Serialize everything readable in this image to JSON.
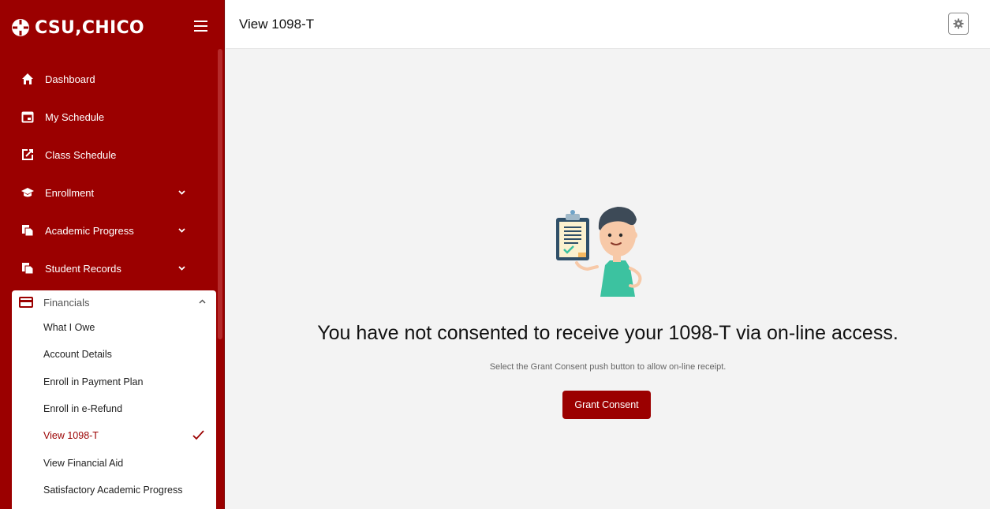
{
  "brand": {
    "logo_text": "CSU,CHICO",
    "color": "#9b0000"
  },
  "header": {
    "title": "View 1098-T"
  },
  "sidebar": {
    "items": [
      {
        "label": "Dashboard",
        "icon": "home-icon"
      },
      {
        "label": "My Schedule",
        "icon": "calendar-icon"
      },
      {
        "label": "Class Schedule",
        "icon": "external-edit-icon"
      },
      {
        "label": "Enrollment",
        "icon": "graduation-cap-icon",
        "expandable": true
      },
      {
        "label": "Academic Progress",
        "icon": "documents-icon",
        "expandable": true
      },
      {
        "label": "Student Records",
        "icon": "documents-icon",
        "expandable": true
      }
    ],
    "financials": {
      "label": "Financials",
      "icon": "credit-card-icon",
      "expanded": true,
      "items": [
        {
          "label": "What I Owe"
        },
        {
          "label": "Account Details"
        },
        {
          "label": "Enroll in Payment Plan"
        },
        {
          "label": "Enroll in e-Refund"
        },
        {
          "label": "View 1098-T",
          "active": true
        },
        {
          "label": "View Financial Aid"
        },
        {
          "label": "Satisfactory Academic Progress"
        }
      ]
    }
  },
  "main": {
    "headline": "You have not consented to receive your 1098-T via on-line access.",
    "subtext": "Select the Grant Consent push button to allow on-line receipt.",
    "button_label": "Grant Consent"
  }
}
